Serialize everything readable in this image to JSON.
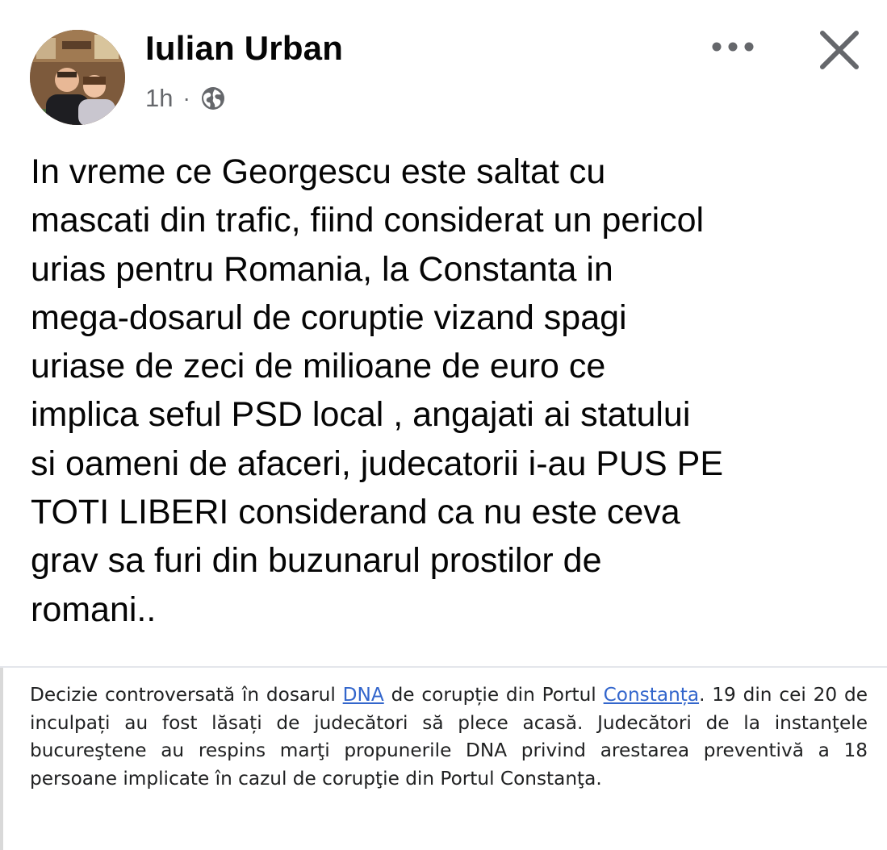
{
  "post": {
    "author": "Iulian Urban",
    "time": "1h",
    "separator": "·",
    "privacy_icon": "globe-icon",
    "body": "In vreme ce Georgescu este saltat cu\nmascati din trafic, fiind considerat un pericol\nurias pentru Romania, la Constanta in\nmega-dosarul de coruptie vizand spagi\nuriase de zeci de milioane de euro ce\nimplica seful PSD local , angajati ai statului\nsi oameni de afaceri, judecatorii i-au PUS PE\nTOTI LIBERI considerand ca nu este ceva\ngrav sa furi din buzunarul prostilor de\nromani..",
    "actions": {
      "more_icon": "more-options-icon",
      "close_icon": "close-icon"
    }
  },
  "quote": {
    "part1": "Decizie controversată în dosarul ",
    "link1": "DNA",
    "part2": " de corupție din Portul ",
    "link2": "Constanța",
    "part3": ". 19 din cei 20 de inculpați au fost lăsați de judecători să plece acasă. Judecători de la instanţele bucureştene au respins marţi propunerile DNA privind arestarea preventivă a 18 persoane implicate în cazul de corupţie din Portul Constanţa."
  },
  "colors": {
    "text": "#050505",
    "secondary": "#65676b",
    "link": "#3366cc",
    "quote_text": "#202122"
  }
}
